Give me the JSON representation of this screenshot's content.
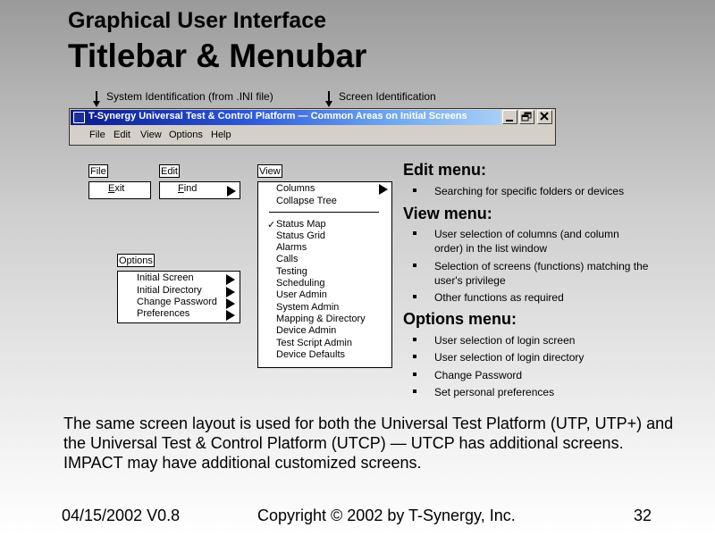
{
  "slide": {
    "title": "Graphical User Interface",
    "subtitle": "Titlebar & Menubar"
  },
  "annotations": {
    "system_id": "System Identification (from .INI file)",
    "screen_id": "Screen Identification"
  },
  "window": {
    "title": "T-Synergy Universal Test & Control Platform — Common Areas on Initial Screens",
    "menu": [
      "File",
      "Edit",
      "View",
      "Options",
      "Help"
    ]
  },
  "menus": {
    "file": {
      "label": "File",
      "items": [
        "Exit"
      ]
    },
    "edit": {
      "label": "Edit",
      "items": [
        "Find"
      ]
    },
    "view": {
      "label": "View",
      "items": [
        "Columns",
        "Collapse Tree",
        "Status Map",
        "Status Grid",
        "Alarms",
        "Calls",
        "Testing",
        "Scheduling",
        "User Admin",
        "System Admin",
        "Mapping & Directory",
        "Device Admin",
        "Test Script Admin",
        "Device Defaults"
      ],
      "check_mark": "✓"
    },
    "options": {
      "label": "Options",
      "items": [
        "Initial Screen",
        "Initial Directory",
        "Change Password",
        "Preferences"
      ]
    }
  },
  "descriptions": {
    "edit": {
      "heading": "Edit menu:",
      "bullets": [
        "Searching for specific folders or devices"
      ]
    },
    "view": {
      "heading": "View menu:",
      "bullets": [
        "User selection of columns (and column order) in the list window",
        "Selection of screens (functions) matching the user's privilege",
        "Other functions as required"
      ]
    },
    "options": {
      "heading": "Options menu:",
      "bullets": [
        "User selection of login screen",
        "User selection of login directory",
        "Change Password",
        "Set personal preferences"
      ]
    }
  },
  "paragraph": "The same screen layout is used for both the Universal Test Platform (UTP, UTP+) and the Universal Test & Control Platform (UTCP) — UTCP has additional screens. IMPACT may have additional customized screens.",
  "footer": {
    "date_version": "04/15/2002 V0.8",
    "copyright": "Copyright © 2002 by T-Synergy, Inc.",
    "page": "32"
  }
}
